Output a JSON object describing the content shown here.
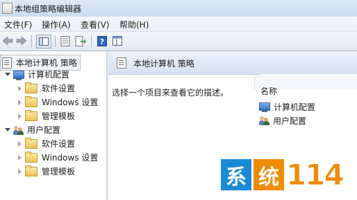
{
  "window": {
    "title": "本地组策略编辑器"
  },
  "menu": [
    "文件(F)",
    "操作(A)",
    "查看(V)",
    "帮助(H)"
  ],
  "tree": {
    "root": "本地计算机 策略",
    "computer_config": "计算机配置",
    "user_config": "用户配置",
    "computer_children": [
      "软件设置",
      "Windows 设置",
      "管理模板"
    ],
    "user_children": [
      "软件设置",
      "Windows 设置",
      "管理模板"
    ]
  },
  "details": {
    "header_title": "本地计算机 策略",
    "description": "选择一个项目来查看它的描述。",
    "column_name": "名称",
    "items": [
      "计算机配置",
      "用户配置"
    ]
  },
  "watermark": {
    "char1": "系",
    "char2": "统",
    "number": "114",
    "color1": "#1b8ad6",
    "color2": "#f08a00"
  }
}
